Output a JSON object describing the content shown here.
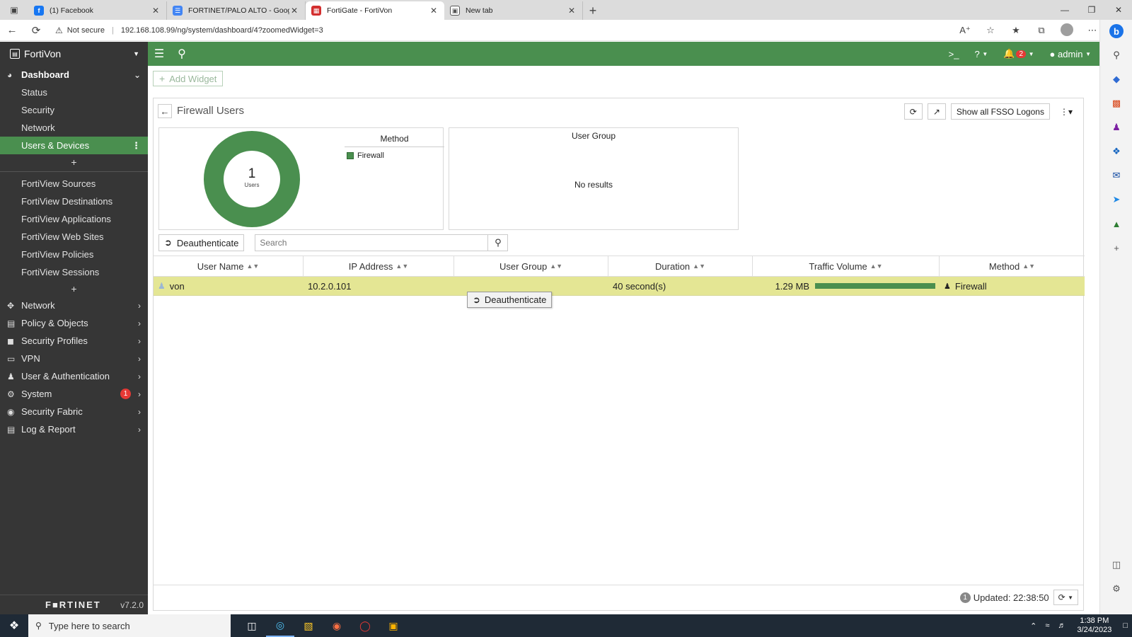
{
  "browser": {
    "tabs": [
      {
        "title": "(1) Facebook",
        "active": false
      },
      {
        "title": "FORTINET/PALO ALTO - Google D",
        "active": false
      },
      {
        "title": "FortiGate - FortiVon",
        "active": true
      },
      {
        "title": "New tab",
        "active": false
      }
    ],
    "not_secure": "Not secure",
    "url": "192.168.108.99/ng/system/dashboard/4?zoomedWidget=3"
  },
  "app": {
    "name": "FortiVon",
    "topbar": {
      "cli": ">_",
      "help": "?",
      "alerts_count": "2",
      "user": "admin"
    }
  },
  "sidebar": {
    "dashboard": "Dashboard",
    "dashboard_items": [
      "Status",
      "Security",
      "Network",
      "Users & Devices"
    ],
    "fortiview_items": [
      "FortiView Sources",
      "FortiView Destinations",
      "FortiView Applications",
      "FortiView Web Sites",
      "FortiView Policies",
      "FortiView Sessions"
    ],
    "sections": [
      {
        "label": "Network",
        "icon": "network-icon"
      },
      {
        "label": "Policy & Objects",
        "icon": "policy-icon"
      },
      {
        "label": "Security Profiles",
        "icon": "lock-icon"
      },
      {
        "label": "VPN",
        "icon": "laptop-icon"
      },
      {
        "label": "User & Authentication",
        "icon": "user-icon"
      },
      {
        "label": "System",
        "icon": "gear-icon"
      },
      {
        "label": "Security Fabric",
        "icon": "fabric-icon"
      },
      {
        "label": "Log & Report",
        "icon": "chart-icon"
      }
    ],
    "system_badge": "1",
    "brand": "F■RTINET",
    "version": "v7.2.0"
  },
  "main": {
    "add_widget": "Add Widget",
    "widget_title": "Firewall Users",
    "show_all_fsso": "Show all FSSO Logons",
    "donut": {
      "count": "1",
      "label": "Users"
    },
    "legend": {
      "title": "Method",
      "items": [
        "Firewall"
      ]
    },
    "user_group": {
      "title": "User Group",
      "empty": "No results"
    },
    "deauthenticate": "Deauthenticate",
    "search_placeholder": "Search",
    "columns": [
      "User Name",
      "IP Address",
      "User Group",
      "Duration",
      "Traffic Volume",
      "Method"
    ],
    "rows": [
      {
        "user": "von",
        "ip": "10.2.0.101",
        "group": "",
        "duration": "40 second(s)",
        "traffic": "1.29 MB",
        "method": "Firewall"
      }
    ],
    "context_button": "Deauthenticate",
    "info_count": "1",
    "updated": "Updated: 22:38:50"
  },
  "taskbar": {
    "search_placeholder": "Type here to search",
    "time": "1:38 PM",
    "date": "3/24/2023"
  },
  "colors": {
    "accent": "#4a8f4f",
    "sidebar_bg": "#363636",
    "row_highlight": "#e4e694"
  }
}
